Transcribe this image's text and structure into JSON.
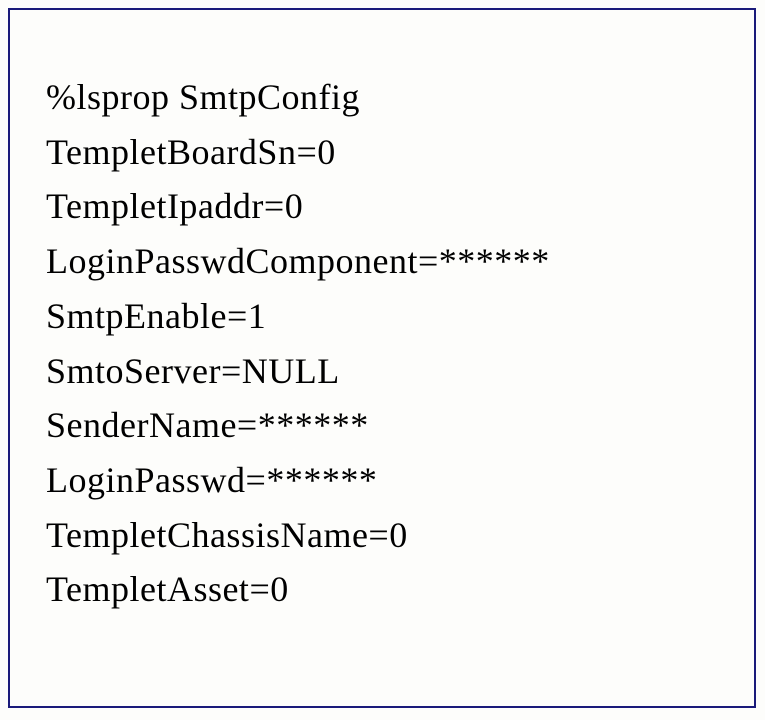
{
  "terminal": {
    "lines": [
      "%lsprop SmtpConfig",
      "TempletBoardSn=0",
      "TempletIpaddr=0",
      "LoginPasswdComponent=******",
      "SmtpEnable=1",
      "SmtoServer=NULL",
      "SenderName=******",
      "LoginPasswd=******",
      "TempletChassisName=0",
      "TempletAsset=0"
    ]
  }
}
